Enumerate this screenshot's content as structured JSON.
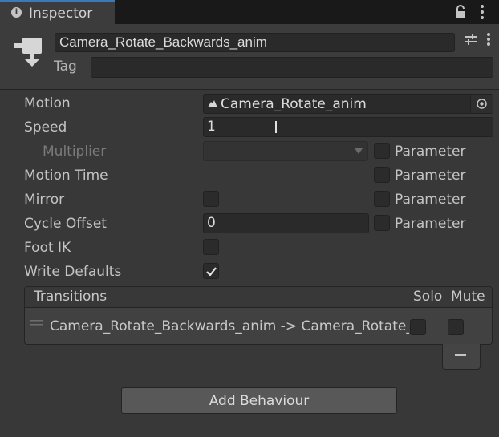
{
  "tab": {
    "title": "Inspector",
    "icon": "info-icon"
  },
  "header": {
    "state_name": "Camera_Rotate_Backwards_anim",
    "tag_label": "Tag",
    "tag_value": ""
  },
  "properties": {
    "motion": {
      "label": "Motion",
      "value": "Camera_Rotate_anim"
    },
    "speed": {
      "label": "Speed",
      "value": "1"
    },
    "multiplier": {
      "label": "Multiplier",
      "value": ""
    },
    "motion_time": {
      "label": "Motion Time"
    },
    "mirror": {
      "label": "Mirror",
      "checked": false
    },
    "cycle_offset": {
      "label": "Cycle Offset",
      "value": "0"
    },
    "foot_ik": {
      "label": "Foot IK",
      "checked": false
    },
    "write_defaults": {
      "label": "Write Defaults",
      "checked": true
    },
    "parameter_label": "Parameter"
  },
  "transitions": {
    "title": "Transitions",
    "solo_label": "Solo",
    "mute_label": "Mute",
    "items": [
      {
        "text": "Camera_Rotate_Backwards_anim -> Camera_Rotate_anim",
        "solo": false,
        "mute": false
      }
    ]
  },
  "add_behaviour_label": "Add Behaviour"
}
